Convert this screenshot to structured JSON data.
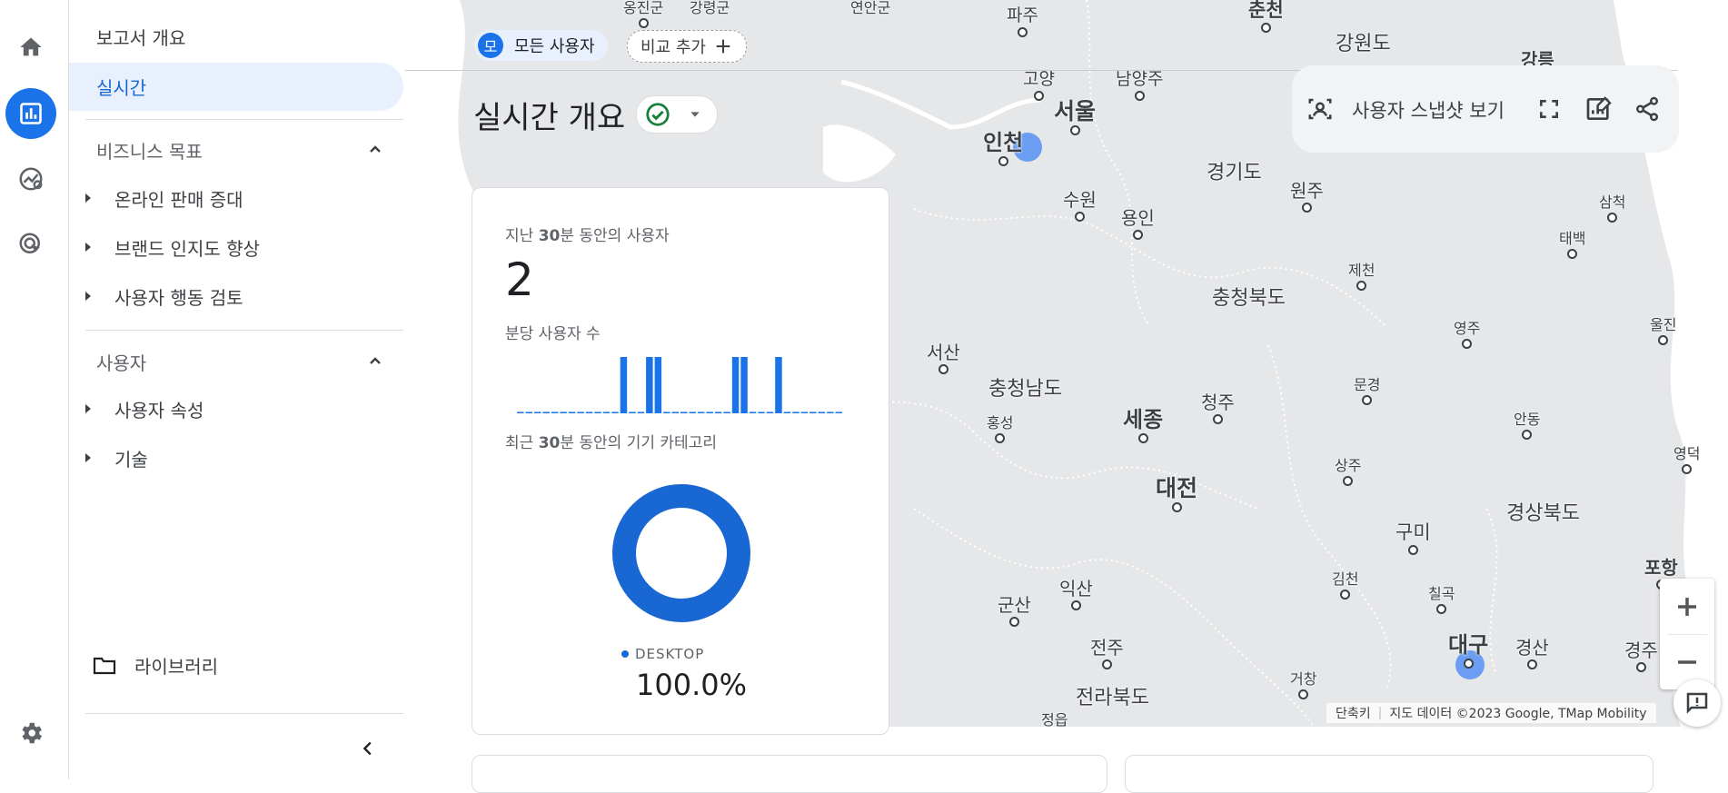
{
  "rail": {
    "items": [
      "home-icon",
      "reports-icon",
      "explore-icon",
      "advertising-icon"
    ],
    "settings": "settings-icon"
  },
  "nav": {
    "overview": "보고서 개요",
    "realtime": "실시간",
    "business_goals": {
      "title": "비즈니스 목표",
      "items": [
        "온라인 판매 증대",
        "브랜드 인지도 향상",
        "사용자 행동 검토"
      ]
    },
    "user": {
      "title": "사용자",
      "items": [
        "사용자 속성",
        "기술"
      ]
    },
    "library": "라이브러리"
  },
  "header": {
    "chip_avatar": "모",
    "chip_all_users": "모든 사용자",
    "chip_add_compare": "비교 추가",
    "title": "실시간 개요"
  },
  "toolbar": {
    "snapshot": "사용자 스냅샷 보기"
  },
  "card": {
    "users_label_pre": "지난 ",
    "users_label_bold": "30",
    "users_label_post": "분 동안의 사용자",
    "users_value": "2",
    "per_minute_label": "분당 사용자 수",
    "per_minute_values": [
      0,
      0,
      0,
      0,
      0,
      0,
      0,
      0,
      0,
      0,
      0,
      0,
      1,
      0,
      0,
      1,
      1,
      0,
      0,
      0,
      0,
      0,
      0,
      0,
      0,
      1,
      1,
      0,
      0,
      0,
      1,
      0,
      0,
      0,
      0,
      0,
      0,
      0
    ],
    "device_label_pre": "최근 ",
    "device_label_bold": "30",
    "device_label_post": "분 동안의 기기 카테고리",
    "device_name": "DESKTOP",
    "device_pct": "100.0%"
  },
  "map": {
    "labels": [
      {
        "t": "옹진군",
        "s": 16,
        "b": false,
        "dot": true
      },
      {
        "t": "강령군",
        "s": 16,
        "b": false,
        "dot": false
      },
      {
        "t": "연안군",
        "s": 16,
        "b": false,
        "dot": false
      },
      {
        "t": "파주",
        "s": 19,
        "b": false,
        "dot": true
      },
      {
        "t": "춘천",
        "s": 21,
        "b": true,
        "dot": true
      },
      {
        "t": "강원도",
        "s": 22,
        "b": false,
        "dot": false
      },
      {
        "t": "강릉",
        "s": 20,
        "b": true,
        "dot": false
      },
      {
        "t": "고양",
        "s": 19,
        "b": false,
        "dot": true
      },
      {
        "t": "남양주",
        "s": 19,
        "b": false,
        "dot": true
      },
      {
        "t": "서울",
        "s": 25,
        "b": true,
        "dot": true
      },
      {
        "t": "인천",
        "s": 24,
        "b": true,
        "dot": true
      },
      {
        "t": "경기도",
        "s": 22,
        "b": false,
        "dot": false
      },
      {
        "t": "원주",
        "s": 20,
        "b": false,
        "dot": true
      },
      {
        "t": "삼척",
        "s": 16,
        "b": false,
        "dot": true
      },
      {
        "t": "수원",
        "s": 20,
        "b": false,
        "dot": true
      },
      {
        "t": "용인",
        "s": 20,
        "b": false,
        "dot": true
      },
      {
        "t": "태백",
        "s": 16,
        "b": false,
        "dot": true
      },
      {
        "t": "제천",
        "s": 16,
        "b": false,
        "dot": true
      },
      {
        "t": "충청북도",
        "s": 22,
        "b": false,
        "dot": false
      },
      {
        "t": "영주",
        "s": 16,
        "b": false,
        "dot": true
      },
      {
        "t": "울진",
        "s": 16,
        "b": false,
        "dot": true
      },
      {
        "t": "서산",
        "s": 20,
        "b": false,
        "dot": true
      },
      {
        "t": "충청남도",
        "s": 22,
        "b": false,
        "dot": false
      },
      {
        "t": "문경",
        "s": 16,
        "b": false,
        "dot": true
      },
      {
        "t": "청주",
        "s": 20,
        "b": false,
        "dot": true
      },
      {
        "t": "세종",
        "s": 24,
        "b": true,
        "dot": true
      },
      {
        "t": "홍성",
        "s": 16,
        "b": false,
        "dot": true
      },
      {
        "t": "안동",
        "s": 16,
        "b": false,
        "dot": true
      },
      {
        "t": "영덕",
        "s": 16,
        "b": false,
        "dot": true
      },
      {
        "t": "상주",
        "s": 16,
        "b": false,
        "dot": true
      },
      {
        "t": "대전",
        "s": 25,
        "b": true,
        "dot": true
      },
      {
        "t": "경상북도",
        "s": 22,
        "b": false,
        "dot": false
      },
      {
        "t": "구미",
        "s": 21,
        "b": false,
        "dot": true
      },
      {
        "t": "포항",
        "s": 20,
        "b": true,
        "dot": true
      },
      {
        "t": "김천",
        "s": 16,
        "b": false,
        "dot": true
      },
      {
        "t": "칠곡",
        "s": 16,
        "b": false,
        "dot": true
      },
      {
        "t": "군산",
        "s": 20,
        "b": false,
        "dot": true
      },
      {
        "t": "익산",
        "s": 20,
        "b": false,
        "dot": true
      },
      {
        "t": "대구",
        "s": 24,
        "b": true,
        "dot": true
      },
      {
        "t": "경산",
        "s": 20,
        "b": false,
        "dot": true
      },
      {
        "t": "경주",
        "s": 20,
        "b": false,
        "dot": true
      },
      {
        "t": "전주",
        "s": 20,
        "b": false,
        "dot": true
      },
      {
        "t": "거창",
        "s": 16,
        "b": false,
        "dot": true
      },
      {
        "t": "전라북도",
        "s": 22,
        "b": false,
        "dot": false
      },
      {
        "t": "정읍",
        "s": 16,
        "b": false,
        "dot": false
      }
    ],
    "attribution_shortcuts": "단축키",
    "attribution_data": "지도 데이터 ©2023 Google, TMap Mobility"
  },
  "colors": {
    "accent": "#1a73e8",
    "bar": "#1a73e8",
    "donut": "#1967d2",
    "map_bg": "#e6e7e9",
    "sea": "#ffffff"
  }
}
